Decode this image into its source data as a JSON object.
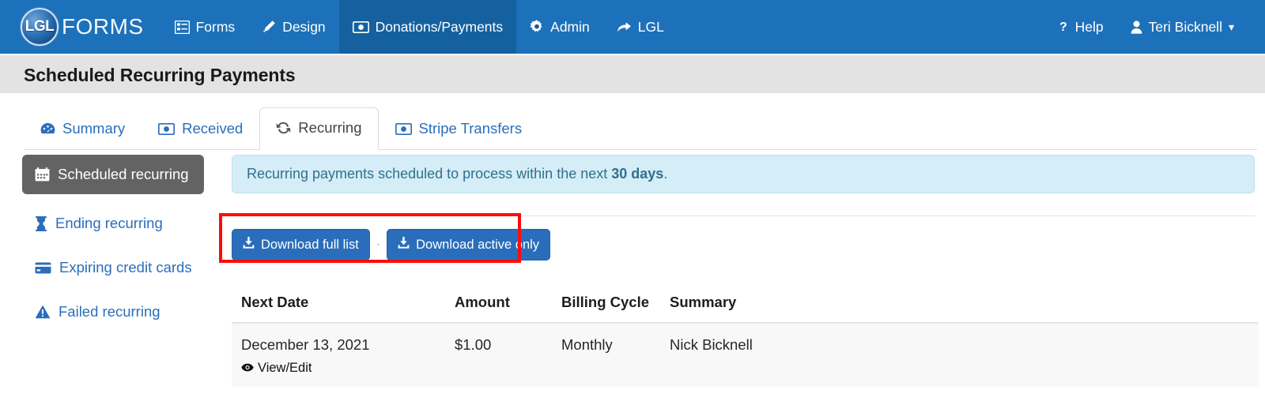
{
  "navbar": {
    "brand": {
      "badge_text": "LGL",
      "word": "FORMS",
      "icon": "lgl-forms-logo"
    },
    "items": [
      {
        "label": "Forms",
        "icon": "list-alt-icon",
        "active": false
      },
      {
        "label": "Design",
        "icon": "pencil-icon",
        "active": false
      },
      {
        "label": "Donations/Payments",
        "icon": "money-bill-icon",
        "active": true
      },
      {
        "label": "Admin",
        "icon": "gear-icon",
        "active": false
      },
      {
        "label": "LGL",
        "icon": "share-arrow-icon",
        "active": false
      }
    ],
    "right_items": [
      {
        "label": "Help",
        "icon": "question-mark-icon"
      },
      {
        "label": "Teri Bicknell",
        "icon": "user-icon",
        "caret": "▾"
      }
    ]
  },
  "page": {
    "title": "Scheduled Recurring Payments"
  },
  "tabs": [
    {
      "label": "Summary",
      "icon": "dashboard-icon",
      "active": false
    },
    {
      "label": "Received",
      "icon": "money-bill-icon",
      "active": false
    },
    {
      "label": "Recurring",
      "icon": "refresh-cycle-icon",
      "active": true
    },
    {
      "label": "Stripe Transfers",
      "icon": "money-bill-icon",
      "active": false
    }
  ],
  "sidebar": {
    "items": [
      {
        "label": "Scheduled recurring",
        "icon": "calendar-icon",
        "active": true
      },
      {
        "label": "Ending recurring",
        "icon": "hourglass-icon",
        "active": false
      },
      {
        "label": "Expiring credit cards",
        "icon": "credit-card-icon",
        "active": false
      },
      {
        "label": "Failed recurring",
        "icon": "warning-triangle-icon",
        "active": false
      }
    ]
  },
  "main": {
    "alert": {
      "text_before": "Recurring payments scheduled to process within the next ",
      "text_strong": "30 days",
      "text_after": "."
    },
    "downloads": {
      "full_list_label": "Download full list",
      "separator": "·",
      "active_only_label": "Download active only",
      "icon": "download-icon",
      "highlight_color": "#fb0d0d"
    },
    "table": {
      "columns": [
        "Next Date",
        "Amount",
        "Billing Cycle",
        "Summary"
      ],
      "rows": [
        {
          "next_date": "December 13, 2021",
          "view_edit_label": "View/Edit",
          "view_edit_icon": "eye-icon",
          "amount": "$1.00",
          "billing_cycle": "Monthly",
          "summary": "Nick Bicknell"
        }
      ]
    }
  },
  "colors": {
    "nav_blue": "#1d71ba",
    "nav_active_blue": "#15619f",
    "link_blue": "#2a6ebb",
    "title_bar_gray": "#e3e3e3",
    "sidebar_active_gray": "#636363",
    "alert_bg": "#d5edf6",
    "alert_text": "#31708f",
    "highlight_red": "#fb0d0d"
  }
}
